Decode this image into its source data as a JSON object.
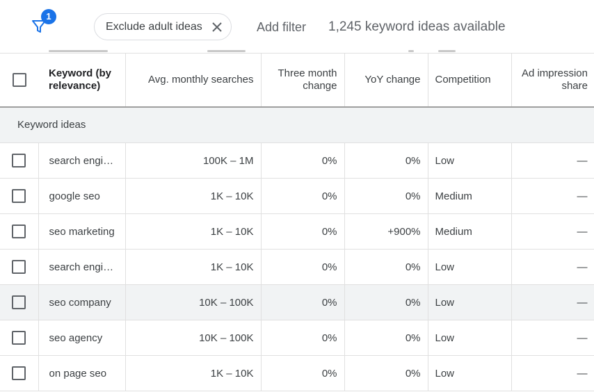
{
  "filter": {
    "badge_count": "1",
    "icon": "filter-funnel-icon"
  },
  "chip": {
    "label": "Exclude adult ideas",
    "close_icon": "close-icon"
  },
  "add_filter_label": "Add filter",
  "ideas_available": "1,245 keyword ideas available",
  "colors": {
    "accent": "#1a73e8",
    "group_bg": "#f1f3f4",
    "border": "#e0e0e0"
  },
  "columns": {
    "keyword": "Keyword (by relevance)",
    "avg_searches": "Avg. monthly searches",
    "three_month": "Three month change",
    "yoy": "YoY change",
    "competition": "Competition",
    "ad_share": "Ad impression share"
  },
  "group_label": "Keyword ideas",
  "rows": [
    {
      "keyword": "search engine optimization",
      "searches": "100K – 1M",
      "three_month": "0%",
      "yoy": "0%",
      "competition": "Low",
      "ad_share": "—"
    },
    {
      "keyword": "google seo",
      "searches": "1K – 10K",
      "three_month": "0%",
      "yoy": "0%",
      "competition": "Medium",
      "ad_share": "—"
    },
    {
      "keyword": "seo marketing",
      "searches": "1K – 10K",
      "three_month": "0%",
      "yoy": "+900%",
      "competition": "Medium",
      "ad_share": "—"
    },
    {
      "keyword": "search engine marketing",
      "searches": "1K – 10K",
      "three_month": "0%",
      "yoy": "0%",
      "competition": "Low",
      "ad_share": "—"
    },
    {
      "keyword": "seo company",
      "searches": "10K – 100K",
      "three_month": "0%",
      "yoy": "0%",
      "competition": "Low",
      "ad_share": "—"
    },
    {
      "keyword": "seo agency",
      "searches": "10K – 100K",
      "three_month": "0%",
      "yoy": "0%",
      "competition": "Low",
      "ad_share": "—"
    },
    {
      "keyword": "on page seo",
      "searches": "1K – 10K",
      "three_month": "0%",
      "yoy": "0%",
      "competition": "Low",
      "ad_share": "—"
    }
  ]
}
